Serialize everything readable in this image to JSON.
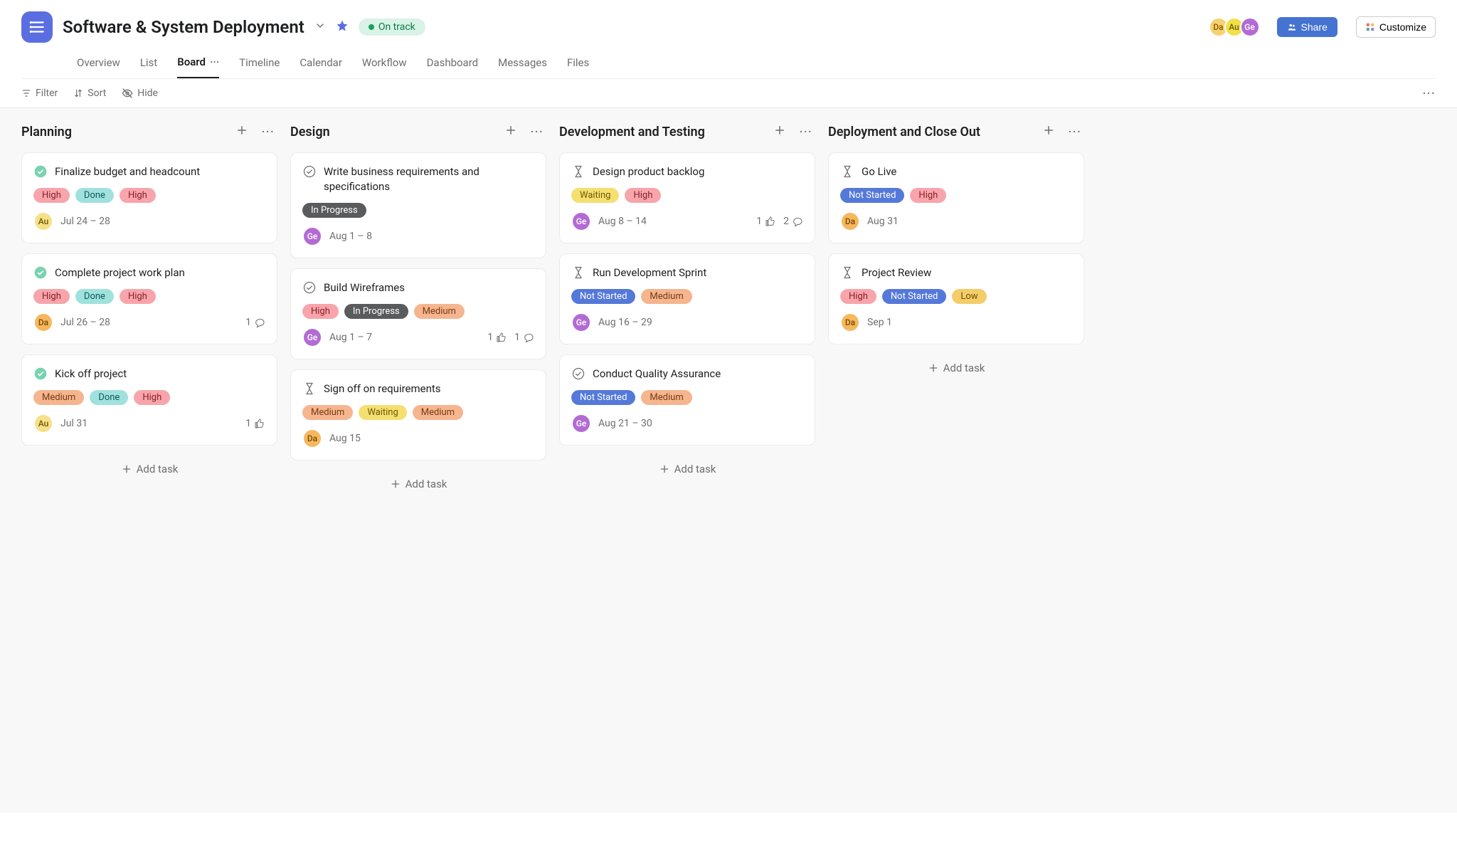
{
  "project": {
    "title": "Software & System Deployment",
    "status": "On track"
  },
  "header": {
    "members": [
      {
        "initials": "Da",
        "bg": "#f7d070",
        "fg": "#845c00"
      },
      {
        "initials": "Au",
        "bg": "#f1e04a",
        "fg": "#6b5b00"
      },
      {
        "initials": "Ge",
        "bg": "#b36bd4",
        "fg": "#fff"
      }
    ],
    "share": "Share",
    "customize": "Customize"
  },
  "tabs": [
    "Overview",
    "List",
    "Board",
    "Timeline",
    "Calendar",
    "Workflow",
    "Dashboard",
    "Messages",
    "Files"
  ],
  "activeTab": "Board",
  "toolbar": {
    "filter": "Filter",
    "sort": "Sort",
    "hide": "Hide"
  },
  "tagStyles": {
    "High": {
      "bg": "#f7a5ab",
      "fg": "#8a1f29"
    },
    "Done": {
      "bg": "#a0e1de",
      "fg": "#0d5c58"
    },
    "Medium": {
      "bg": "#f5b58f",
      "fg": "#7a3b12"
    },
    "In Progress": {
      "bg": "#5a5b5d",
      "fg": "#ffffff"
    },
    "Waiting": {
      "bg": "#f6df71",
      "fg": "#6b5b00"
    },
    "Not Started": {
      "bg": "#5579d9",
      "fg": "#ffffff"
    },
    "Low": {
      "bg": "#f4cc6a",
      "fg": "#6b5100"
    }
  },
  "avatarStyles": {
    "Au": {
      "bg": "#f7e08a",
      "fg": "#6b5b00"
    },
    "Da": {
      "bg": "#f6b85f",
      "fg": "#7a4a00"
    },
    "Ge": {
      "bg": "#b36bd4",
      "fg": "#ffffff"
    }
  },
  "addTaskLabel": "Add task",
  "columns": [
    {
      "title": "Planning",
      "cards": [
        {
          "icon": "done",
          "title": "Finalize budget and headcount",
          "tags": [
            "High",
            "Done",
            "High"
          ],
          "assignee": "Au",
          "date": "Jul 24 – 28"
        },
        {
          "icon": "done",
          "title": "Complete project work plan",
          "tags": [
            "High",
            "Done",
            "High"
          ],
          "assignee": "Da",
          "date": "Jul 26 – 28",
          "comments": 1
        },
        {
          "icon": "done",
          "title": "Kick off project",
          "tags": [
            "Medium",
            "Done",
            "High"
          ],
          "assignee": "Au",
          "date": "Jul 31",
          "likes": 1
        }
      ]
    },
    {
      "title": "Design",
      "cards": [
        {
          "icon": "open",
          "title": "Write business requirements and specifications",
          "tags": [
            "In Progress"
          ],
          "assignee": "Ge",
          "date": "Aug 1 – 8"
        },
        {
          "icon": "open",
          "title": "Build Wireframes",
          "tags": [
            "High",
            "In Progress",
            "Medium"
          ],
          "assignee": "Ge",
          "date": "Aug 1 – 7",
          "likes": 1,
          "comments": 1
        },
        {
          "icon": "pending",
          "title": "Sign off on requirements",
          "tags": [
            "Medium",
            "Waiting",
            "Medium"
          ],
          "assignee": "Da",
          "date": "Aug 15"
        }
      ]
    },
    {
      "title": "Development and Testing",
      "cards": [
        {
          "icon": "pending",
          "title": "Design product backlog",
          "tags": [
            "Waiting",
            "High"
          ],
          "assignee": "Ge",
          "date": "Aug 8 – 14",
          "likes": 1,
          "comments": 2
        },
        {
          "icon": "pending",
          "title": "Run Development Sprint",
          "tags": [
            "Not Started",
            "Medium"
          ],
          "assignee": "Ge",
          "date": "Aug 16 – 29"
        },
        {
          "icon": "open",
          "title": "Conduct Quality Assurance",
          "tags": [
            "Not Started",
            "Medium"
          ],
          "assignee": "Ge",
          "date": "Aug 21 – 30"
        }
      ]
    },
    {
      "title": "Deployment and Close Out",
      "cards": [
        {
          "icon": "pending",
          "title": "Go Live",
          "tags": [
            "Not Started",
            "High"
          ],
          "assignee": "Da",
          "date": "Aug 31"
        },
        {
          "icon": "pending",
          "title": "Project Review",
          "tags": [
            "High",
            "Not Started",
            "Low"
          ],
          "assignee": "Da",
          "date": "Sep 1"
        }
      ]
    }
  ]
}
